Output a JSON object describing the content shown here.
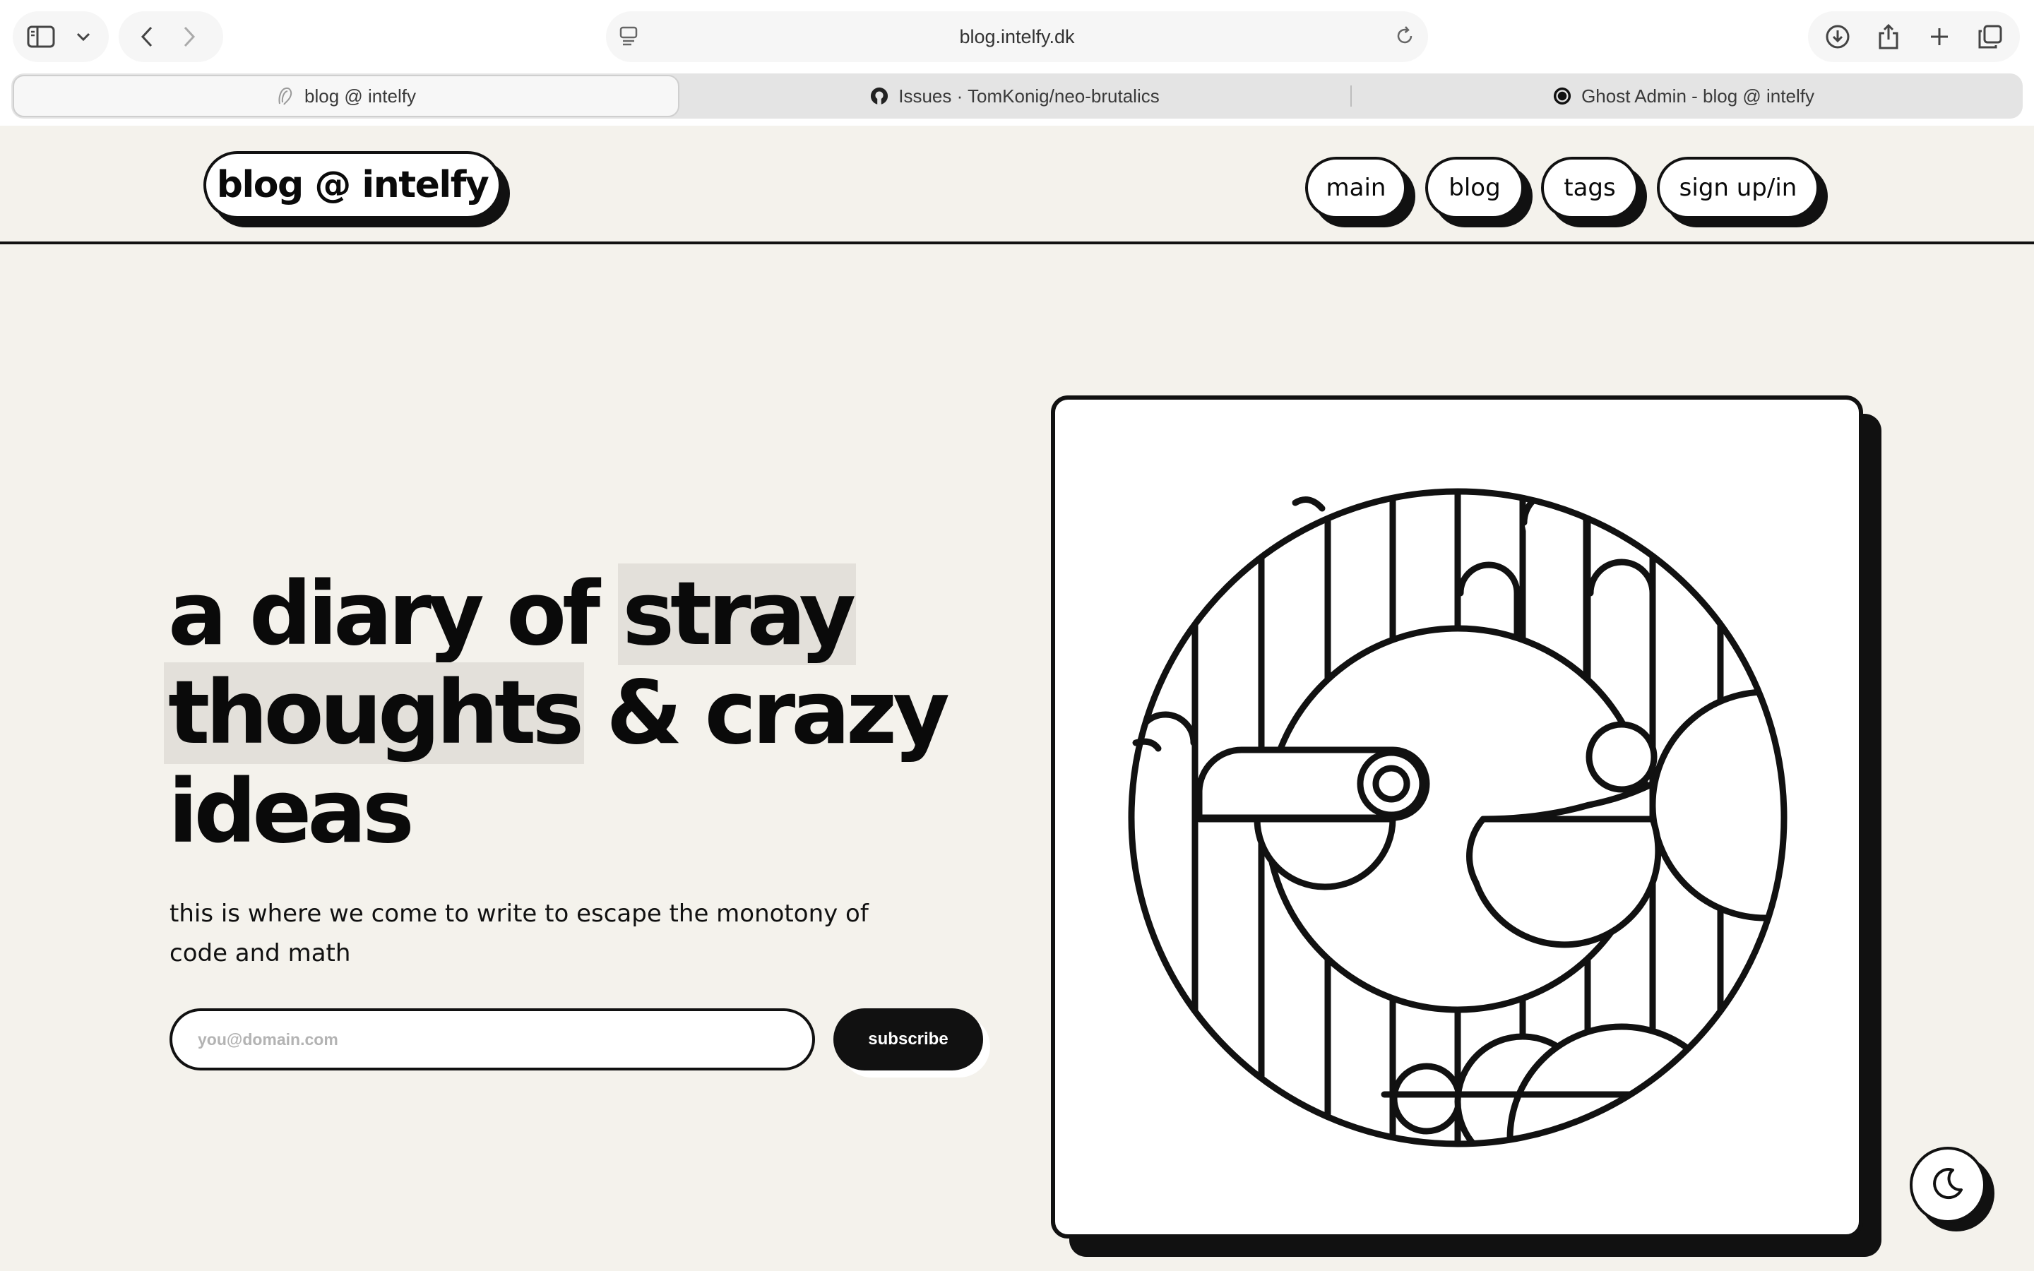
{
  "browser": {
    "url": "blog.intelfy.dk",
    "tabs": [
      {
        "title": "blog @ intelfy",
        "active": true,
        "favicon": "ghost-icon"
      },
      {
        "title": "Issues · TomKonig/neo-brutalics",
        "active": false,
        "favicon": "github-icon"
      },
      {
        "title": "Ghost Admin - blog @ intelfy",
        "active": false,
        "favicon": "ghost-admin-icon"
      }
    ],
    "icons": [
      "sidebar-icon",
      "chevron-down-icon",
      "back-icon",
      "forward-icon",
      "reader-icon",
      "reload-icon",
      "download-icon",
      "share-icon",
      "new-tab-icon",
      "tab-overview-icon"
    ]
  },
  "site": {
    "logo": "blog @ intelfy",
    "nav": [
      "main",
      "blog",
      "tags",
      "sign up/in"
    ]
  },
  "hero": {
    "title_line1_a": "a diary of ",
    "title_line1_b": "stray",
    "title_line2_a": "thoughts",
    "title_line2_b": " & crazy",
    "title_line3": "ideas",
    "subtitle": "this is where we come to write to escape the monotony of code and math",
    "email_placeholder": "you@domain.com",
    "subscribe_label": "subscribe"
  },
  "colors": {
    "background": "#f4f2ec",
    "ink": "#111111",
    "highlight": "#e3e0da"
  }
}
